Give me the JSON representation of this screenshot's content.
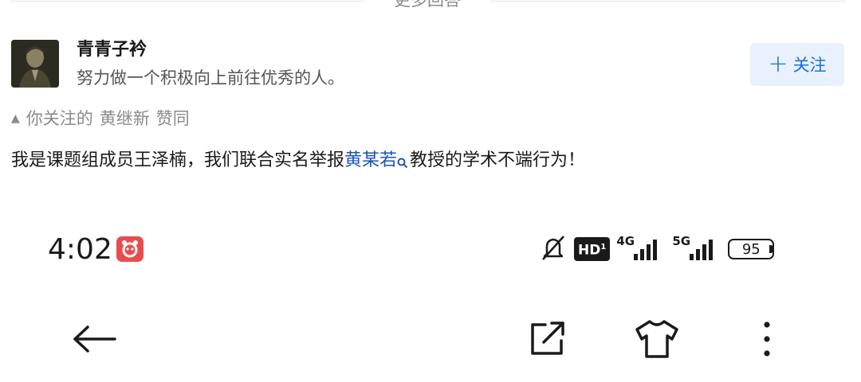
{
  "divider": {
    "label": "更多回答"
  },
  "author": {
    "name": "青青子衿",
    "bio": "努力做一个积极向上前往优秀的人。"
  },
  "follow_button": {
    "icon": "plus-icon",
    "label": "关注"
  },
  "endorsement": {
    "prefix": "你关注的",
    "user": "黄继新",
    "action": "赞同"
  },
  "answer": {
    "before": "我是课题组成员王泽楠，我们联合实名举报",
    "link": "黄某若",
    "after": "教授的学术不端行为！"
  },
  "status_bar": {
    "time": "4:02",
    "alarm_icon": "alarm-app-icon",
    "mute_icon": "bell-off-icon",
    "hd_label": "HD",
    "network1": "4G",
    "network2": "5G",
    "battery": "95"
  },
  "bottom_nav": {
    "back_icon": "back-arrow-icon",
    "share_icon": "share-icon",
    "theme_icon": "shirt-icon",
    "more_icon": "more-vertical-icon"
  },
  "colors": {
    "link": "#1a55b0",
    "accent": "#1a6fe0",
    "follow_bg": "#e8f1fd",
    "alarm": "#e84d4d"
  }
}
